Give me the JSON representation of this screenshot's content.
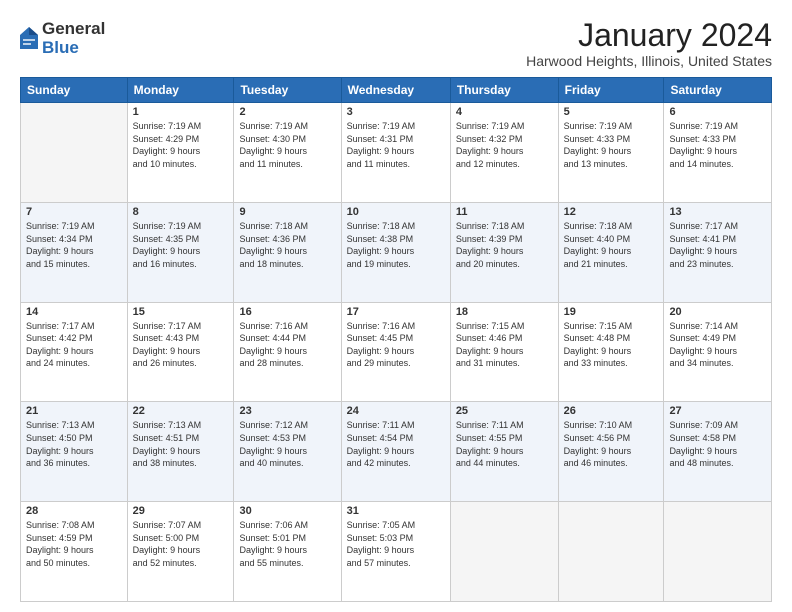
{
  "logo": {
    "general": "General",
    "blue": "Blue"
  },
  "title": "January 2024",
  "subtitle": "Harwood Heights, Illinois, United States",
  "headers": [
    "Sunday",
    "Monday",
    "Tuesday",
    "Wednesday",
    "Thursday",
    "Friday",
    "Saturday"
  ],
  "weeks": [
    [
      {
        "day": "",
        "sunrise": "",
        "sunset": "",
        "daylight": ""
      },
      {
        "day": "1",
        "sunrise": "Sunrise: 7:19 AM",
        "sunset": "Sunset: 4:29 PM",
        "daylight": "Daylight: 9 hours and 10 minutes."
      },
      {
        "day": "2",
        "sunrise": "Sunrise: 7:19 AM",
        "sunset": "Sunset: 4:30 PM",
        "daylight": "Daylight: 9 hours and 11 minutes."
      },
      {
        "day": "3",
        "sunrise": "Sunrise: 7:19 AM",
        "sunset": "Sunset: 4:31 PM",
        "daylight": "Daylight: 9 hours and 11 minutes."
      },
      {
        "day": "4",
        "sunrise": "Sunrise: 7:19 AM",
        "sunset": "Sunset: 4:32 PM",
        "daylight": "Daylight: 9 hours and 12 minutes."
      },
      {
        "day": "5",
        "sunrise": "Sunrise: 7:19 AM",
        "sunset": "Sunset: 4:33 PM",
        "daylight": "Daylight: 9 hours and 13 minutes."
      },
      {
        "day": "6",
        "sunrise": "Sunrise: 7:19 AM",
        "sunset": "Sunset: 4:33 PM",
        "daylight": "Daylight: 9 hours and 14 minutes."
      }
    ],
    [
      {
        "day": "7",
        "sunrise": "Sunrise: 7:19 AM",
        "sunset": "Sunset: 4:34 PM",
        "daylight": "Daylight: 9 hours and 15 minutes."
      },
      {
        "day": "8",
        "sunrise": "Sunrise: 7:19 AM",
        "sunset": "Sunset: 4:35 PM",
        "daylight": "Daylight: 9 hours and 16 minutes."
      },
      {
        "day": "9",
        "sunrise": "Sunrise: 7:18 AM",
        "sunset": "Sunset: 4:36 PM",
        "daylight": "Daylight: 9 hours and 18 minutes."
      },
      {
        "day": "10",
        "sunrise": "Sunrise: 7:18 AM",
        "sunset": "Sunset: 4:38 PM",
        "daylight": "Daylight: 9 hours and 19 minutes."
      },
      {
        "day": "11",
        "sunrise": "Sunrise: 7:18 AM",
        "sunset": "Sunset: 4:39 PM",
        "daylight": "Daylight: 9 hours and 20 minutes."
      },
      {
        "day": "12",
        "sunrise": "Sunrise: 7:18 AM",
        "sunset": "Sunset: 4:40 PM",
        "daylight": "Daylight: 9 hours and 21 minutes."
      },
      {
        "day": "13",
        "sunrise": "Sunrise: 7:17 AM",
        "sunset": "Sunset: 4:41 PM",
        "daylight": "Daylight: 9 hours and 23 minutes."
      }
    ],
    [
      {
        "day": "14",
        "sunrise": "Sunrise: 7:17 AM",
        "sunset": "Sunset: 4:42 PM",
        "daylight": "Daylight: 9 hours and 24 minutes."
      },
      {
        "day": "15",
        "sunrise": "Sunrise: 7:17 AM",
        "sunset": "Sunset: 4:43 PM",
        "daylight": "Daylight: 9 hours and 26 minutes."
      },
      {
        "day": "16",
        "sunrise": "Sunrise: 7:16 AM",
        "sunset": "Sunset: 4:44 PM",
        "daylight": "Daylight: 9 hours and 28 minutes."
      },
      {
        "day": "17",
        "sunrise": "Sunrise: 7:16 AM",
        "sunset": "Sunset: 4:45 PM",
        "daylight": "Daylight: 9 hours and 29 minutes."
      },
      {
        "day": "18",
        "sunrise": "Sunrise: 7:15 AM",
        "sunset": "Sunset: 4:46 PM",
        "daylight": "Daylight: 9 hours and 31 minutes."
      },
      {
        "day": "19",
        "sunrise": "Sunrise: 7:15 AM",
        "sunset": "Sunset: 4:48 PM",
        "daylight": "Daylight: 9 hours and 33 minutes."
      },
      {
        "day": "20",
        "sunrise": "Sunrise: 7:14 AM",
        "sunset": "Sunset: 4:49 PM",
        "daylight": "Daylight: 9 hours and 34 minutes."
      }
    ],
    [
      {
        "day": "21",
        "sunrise": "Sunrise: 7:13 AM",
        "sunset": "Sunset: 4:50 PM",
        "daylight": "Daylight: 9 hours and 36 minutes."
      },
      {
        "day": "22",
        "sunrise": "Sunrise: 7:13 AM",
        "sunset": "Sunset: 4:51 PM",
        "daylight": "Daylight: 9 hours and 38 minutes."
      },
      {
        "day": "23",
        "sunrise": "Sunrise: 7:12 AM",
        "sunset": "Sunset: 4:53 PM",
        "daylight": "Daylight: 9 hours and 40 minutes."
      },
      {
        "day": "24",
        "sunrise": "Sunrise: 7:11 AM",
        "sunset": "Sunset: 4:54 PM",
        "daylight": "Daylight: 9 hours and 42 minutes."
      },
      {
        "day": "25",
        "sunrise": "Sunrise: 7:11 AM",
        "sunset": "Sunset: 4:55 PM",
        "daylight": "Daylight: 9 hours and 44 minutes."
      },
      {
        "day": "26",
        "sunrise": "Sunrise: 7:10 AM",
        "sunset": "Sunset: 4:56 PM",
        "daylight": "Daylight: 9 hours and 46 minutes."
      },
      {
        "day": "27",
        "sunrise": "Sunrise: 7:09 AM",
        "sunset": "Sunset: 4:58 PM",
        "daylight": "Daylight: 9 hours and 48 minutes."
      }
    ],
    [
      {
        "day": "28",
        "sunrise": "Sunrise: 7:08 AM",
        "sunset": "Sunset: 4:59 PM",
        "daylight": "Daylight: 9 hours and 50 minutes."
      },
      {
        "day": "29",
        "sunrise": "Sunrise: 7:07 AM",
        "sunset": "Sunset: 5:00 PM",
        "daylight": "Daylight: 9 hours and 52 minutes."
      },
      {
        "day": "30",
        "sunrise": "Sunrise: 7:06 AM",
        "sunset": "Sunset: 5:01 PM",
        "daylight": "Daylight: 9 hours and 55 minutes."
      },
      {
        "day": "31",
        "sunrise": "Sunrise: 7:05 AM",
        "sunset": "Sunset: 5:03 PM",
        "daylight": "Daylight: 9 hours and 57 minutes."
      },
      {
        "day": "",
        "sunrise": "",
        "sunset": "",
        "daylight": ""
      },
      {
        "day": "",
        "sunrise": "",
        "sunset": "",
        "daylight": ""
      },
      {
        "day": "",
        "sunrise": "",
        "sunset": "",
        "daylight": ""
      }
    ]
  ]
}
